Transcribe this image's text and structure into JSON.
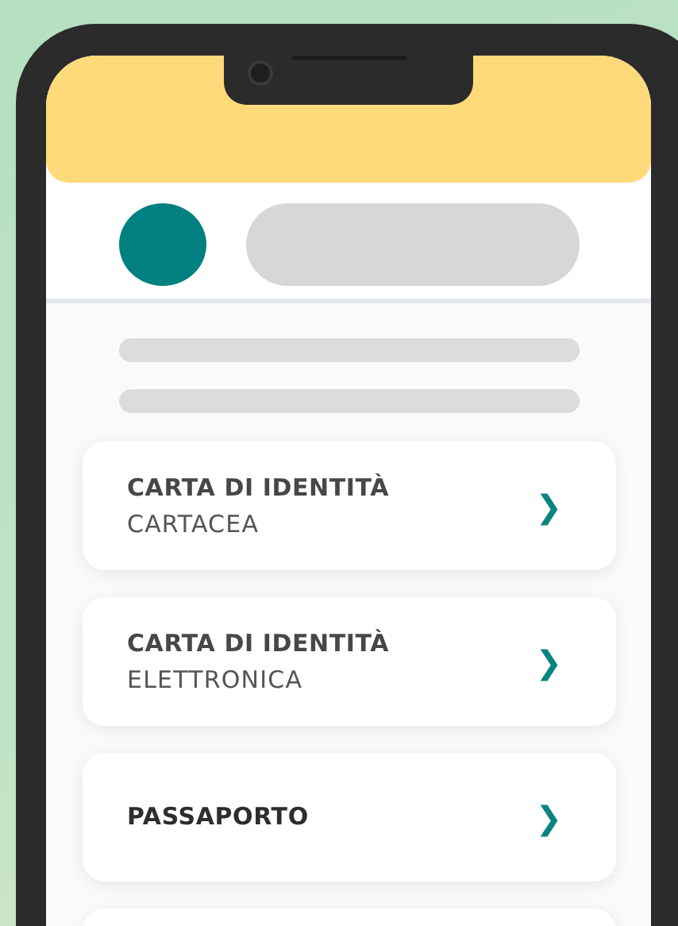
{
  "documents": [
    {
      "kind": "two-line",
      "title": "CARTA DI IDENTITÀ",
      "subtitle": "CARTACEA",
      "chevron": "❯"
    },
    {
      "kind": "two-line",
      "title": "CARTA DI IDENTITÀ",
      "subtitle": "ELETTRONICA",
      "chevron": "❯"
    },
    {
      "kind": "one-line",
      "title": "PASSAPORTO",
      "chevron": "❯"
    },
    {
      "kind": "cut-off"
    }
  ]
}
